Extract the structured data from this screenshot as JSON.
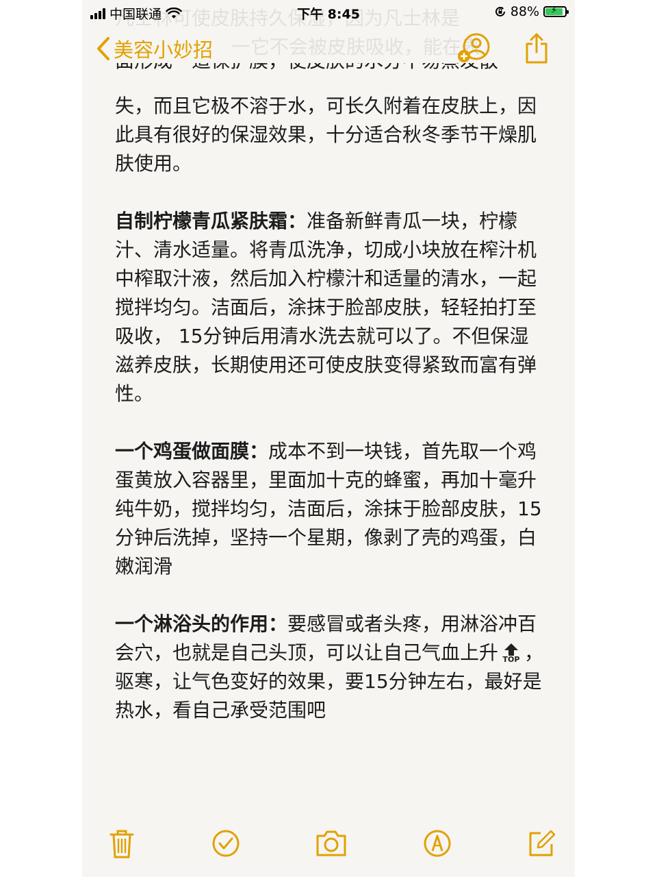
{
  "status_bar": {
    "carrier": "中国联通",
    "time": "下午 8:45",
    "battery": "88%",
    "battery_level": 0.88
  },
  "nav": {
    "back_label": "美容小妙招"
  },
  "ghost_lines": [
    "凡士林可使皮肤持久保湿，因为凡士林是",
    "一它不会被皮肤吸收，能在表"
  ],
  "note": {
    "cut_line": "面形成一道保护膜，使皮肤的水分不易蒸发散",
    "intro": "失，而且它极不溶于水，可长久附着在皮肤上，因此具有很好的保湿效果，十分适合秋冬季节干燥肌肤使用。",
    "sections": [
      {
        "heading": "自制柠檬青瓜紧肤霜：",
        "body": "准备新鲜青瓜一块，柠檬汁、清水适量。将青瓜洗净，切成小块放在榨汁机中榨取汁液，然后加入柠檬汁和适量的清水，一起搅拌均匀。洁面后，涂抹于脸部皮肤，轻轻拍打至吸收， 15分钟后用清水洗去就可以了。不但保湿滋养皮肤，长期使用还可使皮肤变得紧致而富有弹性。"
      },
      {
        "heading": "一个鸡蛋做面膜：",
        "body": "成本不到一块钱，首先取一个鸡蛋黄放入容器里，里面加十克的蜂蜜，再加十毫升纯牛奶，搅拌均匀，洁面后，涂抹于脸部皮肤，15分钟后洗掉，坚持一个星期，像剥了壳的鸡蛋，白嫩润滑"
      },
      {
        "heading": "一个淋浴头的作用：",
        "body_before": "要感冒或者头疼，用淋浴冲百会穴，也就是自己头顶，可以让自己气血上升",
        "emoji_label": "TOP",
        "body_after": "，驱寒，让气色变好的效果，要15分钟左右，最好是热水，看自己承受范围吧"
      }
    ]
  },
  "colors": {
    "accent": "#e1a100",
    "text": "#1c1c1c",
    "background": "#f6f5f2"
  },
  "icons": {
    "back": "chevron-left-icon",
    "add_person": "add-person-icon",
    "share": "share-icon",
    "trash": "trash-icon",
    "checklist": "checkmark-circle-icon",
    "camera": "camera-icon",
    "markup": "markup-pen-icon",
    "compose": "compose-icon"
  }
}
